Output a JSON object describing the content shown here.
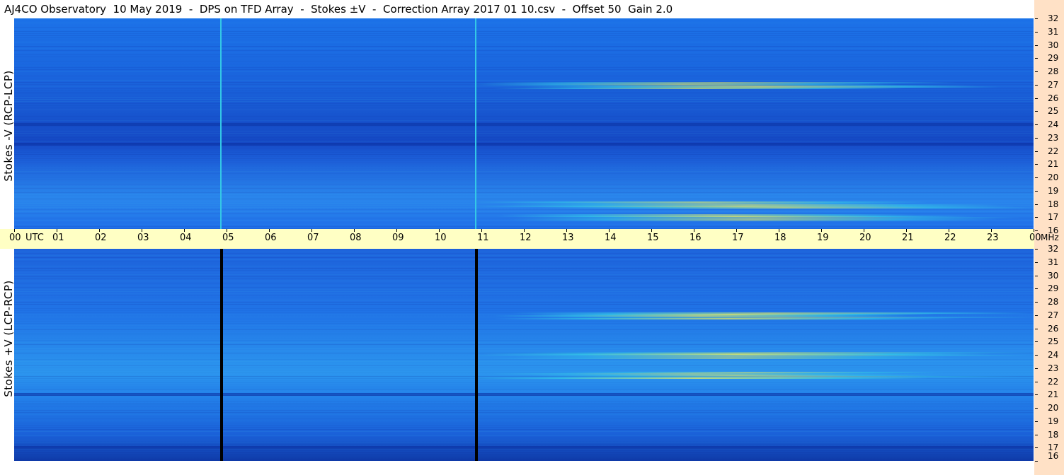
{
  "title": "AJ4CO Observatory  10 May 2019  -  DPS on TFD Array  -  Stokes ±V  -  Correction Array 2017 01 10.csv  -  Offset 50  Gain 2.0",
  "chart_data": {
    "type": "heatmap",
    "title": "AJ4CO Observatory  10 May 2019  -  DPS on TFD Array  -  Stokes ±V  -  Correction Array 2017 01 10.csv  -  Offset 50  Gain 2.0",
    "x_axis": {
      "unit_label": "UTC",
      "ticks": [
        "00",
        "01",
        "02",
        "03",
        "04",
        "05",
        "06",
        "07",
        "08",
        "09",
        "10",
        "11",
        "12",
        "13",
        "14",
        "15",
        "16",
        "17",
        "18",
        "19",
        "20",
        "21",
        "22",
        "23",
        "00"
      ],
      "range": [
        0,
        24
      ]
    },
    "y_axis": {
      "unit_label": "MHz",
      "ticks": [
        "32",
        "31",
        "30",
        "29",
        "28",
        "27",
        "26",
        "25",
        "24",
        "23",
        "22",
        "21",
        "20",
        "19",
        "18",
        "17",
        "16"
      ],
      "range": [
        16,
        32
      ]
    },
    "panels": [
      {
        "label": "Stokes -V (RCP-LCP)",
        "bright_bands_mhz": [
          27,
          17,
          18
        ],
        "dark_bands_mhz": [
          22.5,
          24
        ],
        "vertical_lines_utc": [
          4.85,
          10.85
        ],
        "vertical_line_style": "bright"
      },
      {
        "label": "Stokes +V (LCP-RCP)",
        "bright_bands_mhz": [
          22.5,
          24,
          27
        ],
        "dark_bands_mhz": [
          17,
          21
        ],
        "vertical_lines_utc": [
          4.85,
          10.85
        ],
        "vertical_line_style": "dark"
      }
    ],
    "colors": {
      "base": "#1f6ee8",
      "dark": "#0b2fa0",
      "bright": "#34c8e6",
      "hot": "#e8f060"
    }
  }
}
